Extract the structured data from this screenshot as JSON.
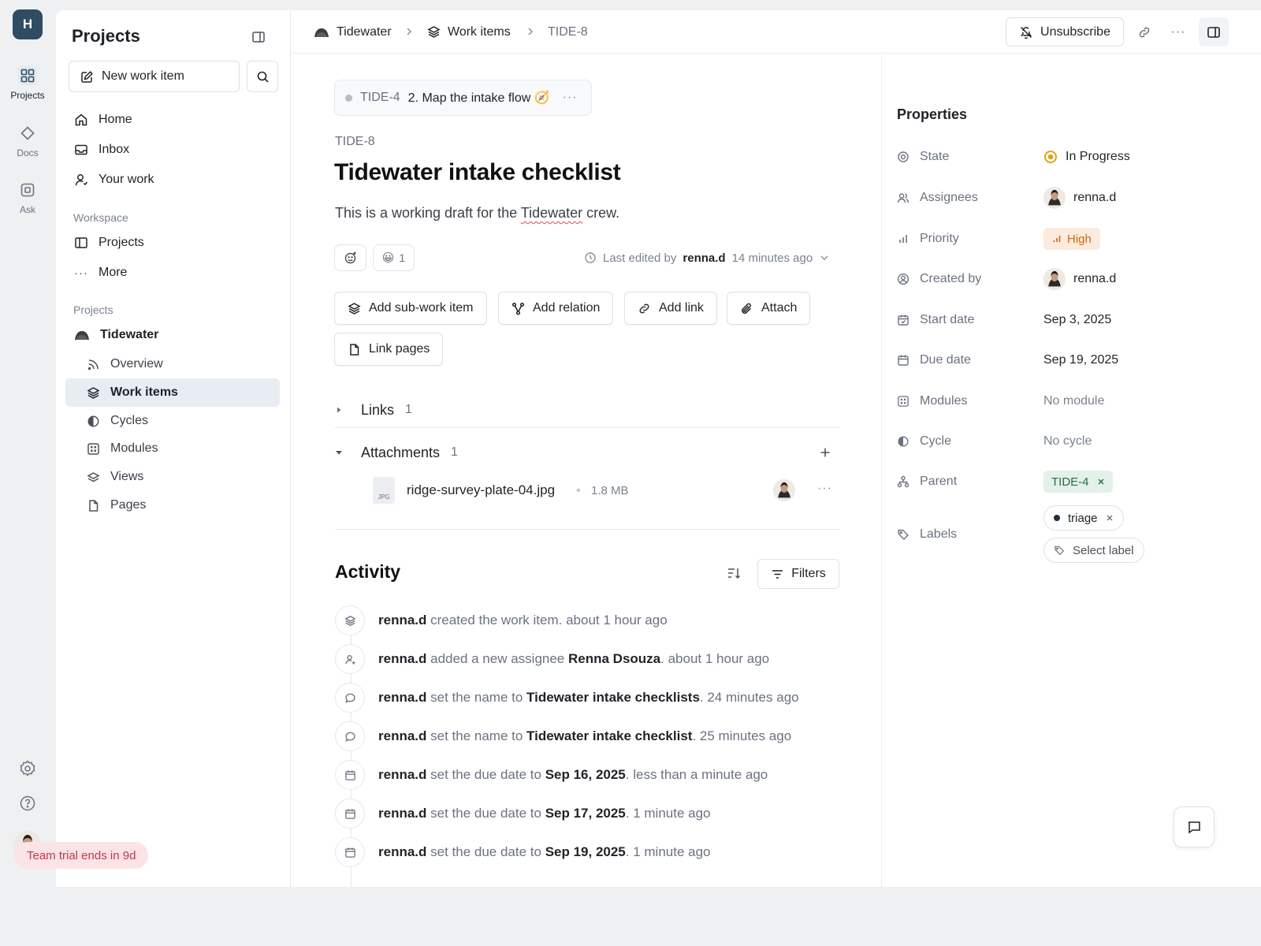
{
  "rail": {
    "workspace_initial": "H",
    "items": [
      {
        "label": "Projects",
        "icon": "grid-icon"
      },
      {
        "label": "Docs",
        "icon": "diamond-icon"
      },
      {
        "label": "Ask",
        "icon": "ask-icon"
      }
    ]
  },
  "sidebar": {
    "title": "Projects",
    "new_item_label": "New work item",
    "nav": [
      "Home",
      "Inbox",
      "Your work"
    ],
    "workspace_label": "Workspace",
    "workspace_items": [
      "Projects",
      "More"
    ],
    "projects_label": "Projects",
    "project_name": "Tidewater",
    "project_items": [
      "Overview",
      "Work items",
      "Cycles",
      "Modules",
      "Views",
      "Pages"
    ],
    "trial_text": "Team trial ends in 9d"
  },
  "header": {
    "breadcrumb": [
      "Tidewater",
      "Work items",
      "TIDE-8"
    ],
    "unsubscribe_label": "Unsubscribe"
  },
  "work_item": {
    "parent_id": "TIDE-4",
    "parent_title": "2. Map the intake flow 🧭",
    "id": "TIDE-8",
    "title": "Tidewater intake checklist",
    "desc_before": "This is a working draft for the ",
    "desc_mark": "Tidewater",
    "desc_after": " crew.",
    "reaction_emoji": "😀",
    "reaction_count": "1",
    "last_edited_label": "Last edited by",
    "last_edited_user": "renna.d",
    "last_edited_time": "14 minutes ago",
    "actions": [
      "Add sub-work item",
      "Add relation",
      "Add link",
      "Attach",
      "Link pages"
    ],
    "links_label": "Links",
    "links_count": "1",
    "attachments_label": "Attachments",
    "attachments_count": "1",
    "attachment": {
      "type": "JPG",
      "name": "ridge-survey-plate-04.jpg",
      "size": "1.8 MB"
    }
  },
  "activity": {
    "title": "Activity",
    "filters_label": "Filters",
    "entries": [
      {
        "icon": "layers-icon",
        "user": "renna.d",
        "text": " created the work item.",
        "value": "",
        "time": " about 1 hour ago"
      },
      {
        "icon": "user-icon",
        "user": "renna.d",
        "text": " added a new assignee ",
        "value": "Renna Dsouza",
        "time": ". about 1 hour ago"
      },
      {
        "icon": "comment-icon",
        "user": "renna.d",
        "text": " set the name to ",
        "value": "Tidewater intake checklists",
        "time": ". 24 minutes ago"
      },
      {
        "icon": "comment-icon",
        "user": "renna.d",
        "text": " set the name to ",
        "value": "Tidewater intake checklist",
        "time": ". 25 minutes ago"
      },
      {
        "icon": "calendar-icon",
        "user": "renna.d",
        "text": " set the due date to ",
        "value": "Sep 16, 2025",
        "time": ". less than a minute ago"
      },
      {
        "icon": "calendar-icon",
        "user": "renna.d",
        "text": " set the due date to ",
        "value": "Sep 17, 2025",
        "time": ". 1 minute ago"
      },
      {
        "icon": "calendar-icon",
        "user": "renna.d",
        "text": " set the due date to ",
        "value": "Sep 19, 2025",
        "time": ". 1 minute ago"
      }
    ]
  },
  "properties": {
    "title": "Properties",
    "state_label": "State",
    "state_value": "In Progress",
    "assignees_label": "Assignees",
    "assignees_value": "renna.d",
    "priority_label": "Priority",
    "priority_value": "High",
    "created_label": "Created by",
    "created_value": "renna.d",
    "start_label": "Start date",
    "start_value": "Sep 3, 2025",
    "due_label": "Due date",
    "due_value": "Sep 19, 2025",
    "modules_label": "Modules",
    "modules_value": "No module",
    "cycle_label": "Cycle",
    "cycle_value": "No cycle",
    "parent_label": "Parent",
    "parent_value": "TIDE-4",
    "labels_label": "Labels",
    "label_tag": "triage",
    "select_label": "Select label"
  },
  "colors": {
    "accent": "#2f4c63",
    "state": "#e0a21a",
    "priority": "#c96a1b",
    "parent": "#2d6a47",
    "trial": "#c0384d"
  }
}
